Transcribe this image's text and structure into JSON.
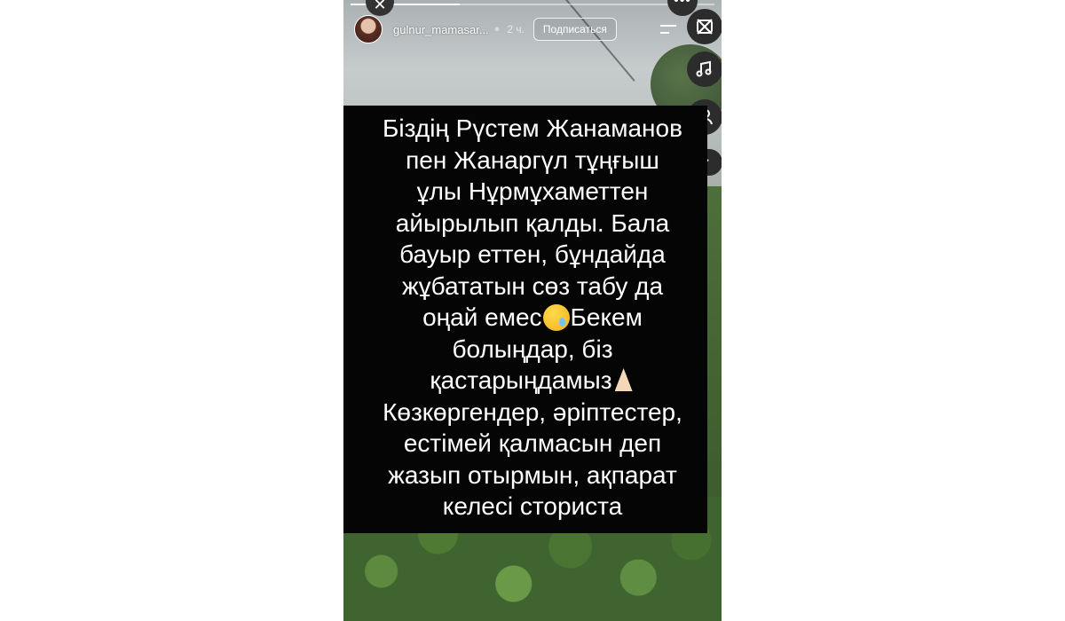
{
  "story": {
    "username": "gulnur_mamasar...",
    "verified_icon": "verified-badge-icon",
    "time_ago": "2 ч.",
    "follow_label": "Подписаться",
    "progress": 0.3,
    "text_lines": [
      "Біздің Рүстем Жанаманов",
      "пен Жанаргүл тұңғыш",
      "ұлы Нұрмұхаметтен",
      "айырылып қалды. Бала",
      "бауыр еттен, бұндайда",
      "жұбататын сөз табу да",
      "оңай емес",
      "Бекем",
      "болыңдар, біз",
      "қастарыңдамыз",
      "Көзкөргендер, әріптестер,",
      "естімей қалмасын деп",
      "жазып отырмын, ақпарат",
      "келесі сториста"
    ]
  },
  "controls": {
    "close_icon": "close-icon",
    "more_icon": "more-icon",
    "mute_icon": "muted-speaker-icon",
    "music_icon": "music-note-icon",
    "mention_icon": "mention-user-icon",
    "chevron_icon": "chevron-down-icon"
  },
  "colors": {
    "text_box": "#050505",
    "text": "#ffffff"
  }
}
